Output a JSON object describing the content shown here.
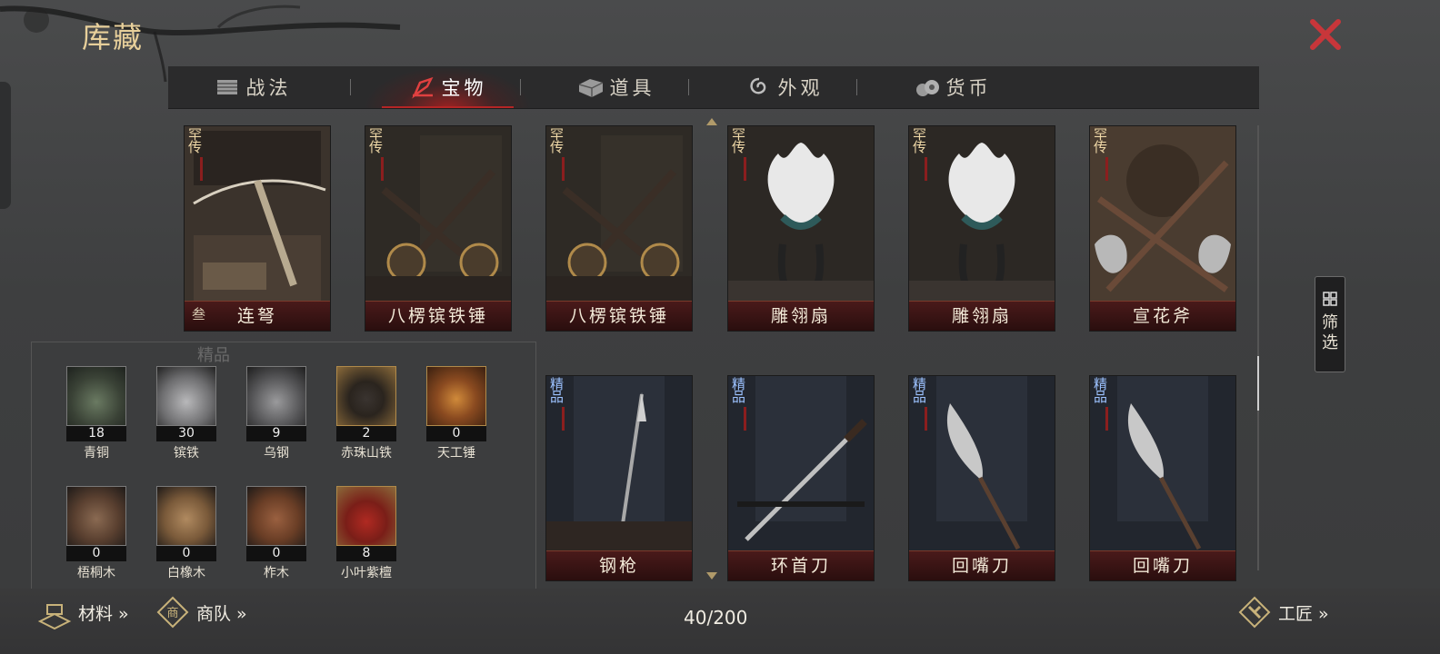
{
  "window": {
    "title": "库藏"
  },
  "tabs": [
    {
      "label": "战法",
      "icon": "scroll-bundle-icon",
      "active": false
    },
    {
      "label": "宝物",
      "icon": "treasure-icon",
      "active": true
    },
    {
      "label": "道具",
      "icon": "chest-icon",
      "active": false
    },
    {
      "label": "外观",
      "icon": "swirl-icon",
      "active": false
    },
    {
      "label": "货币",
      "icon": "coin-bag-icon",
      "active": false
    }
  ],
  "grid": {
    "row1": [
      {
        "name": "连弩",
        "grade": "罕",
        "grade2": "传",
        "level": "叁",
        "art": "crossbow"
      },
      {
        "name": "八楞镔铁锤",
        "grade": "罕",
        "grade2": "传",
        "art": "hammers"
      },
      {
        "name": "八楞镔铁锤",
        "grade": "罕",
        "grade2": "传",
        "art": "hammers"
      },
      {
        "name": "雕翎扇",
        "grade": "罕",
        "grade2": "传",
        "art": "fan"
      },
      {
        "name": "雕翎扇",
        "grade": "罕",
        "grade2": "传",
        "art": "fan"
      },
      {
        "name": "宣花斧",
        "grade": "罕",
        "grade2": "传",
        "art": "axe"
      }
    ],
    "row2": [
      {
        "name": "钢枪",
        "grade": "精",
        "grade2": "品",
        "art": "spear"
      },
      {
        "name": "环首刀",
        "grade": "精",
        "grade2": "品",
        "art": "sword"
      },
      {
        "name": "回嘴刀",
        "grade": "精",
        "grade2": "品",
        "art": "glaive"
      },
      {
        "name": "回嘴刀",
        "grade": "精",
        "grade2": "品",
        "art": "glaive"
      }
    ]
  },
  "filter": {
    "label": "筛选"
  },
  "materials": {
    "faint_label": "精品",
    "items": [
      {
        "name": "青铜",
        "count": "18",
        "color": "#4c5a48"
      },
      {
        "name": "镔铁",
        "count": "30",
        "color": "#8e8e90"
      },
      {
        "name": "乌钢",
        "count": "9",
        "color": "#6b6b6e"
      },
      {
        "name": "赤珠山铁",
        "count": "2",
        "color": "#4a3a30",
        "gold": true
      },
      {
        "name": "天工锤",
        "count": "0",
        "color": "#a8642a",
        "gold": true
      },
      {
        "name": "梧桐木",
        "count": "0",
        "color": "#6e4e3a"
      },
      {
        "name": "白橡木",
        "count": "0",
        "color": "#8a6a48"
      },
      {
        "name": "柞木",
        "count": "0",
        "color": "#7a4e32"
      },
      {
        "name": "小叶紫檀",
        "count": "8",
        "color": "#8a2a22",
        "gold": true
      }
    ]
  },
  "bottom": {
    "materials_label": "材料 »",
    "caravan_label": "商队 »",
    "craftsman_label": "工匠 »",
    "capacity": "40/200"
  },
  "colors": {
    "accent_red": "#b52525",
    "gold": "#e7cf9a",
    "rare_tag": "#f0d9a8",
    "fine_tag": "#9cc2ff"
  }
}
